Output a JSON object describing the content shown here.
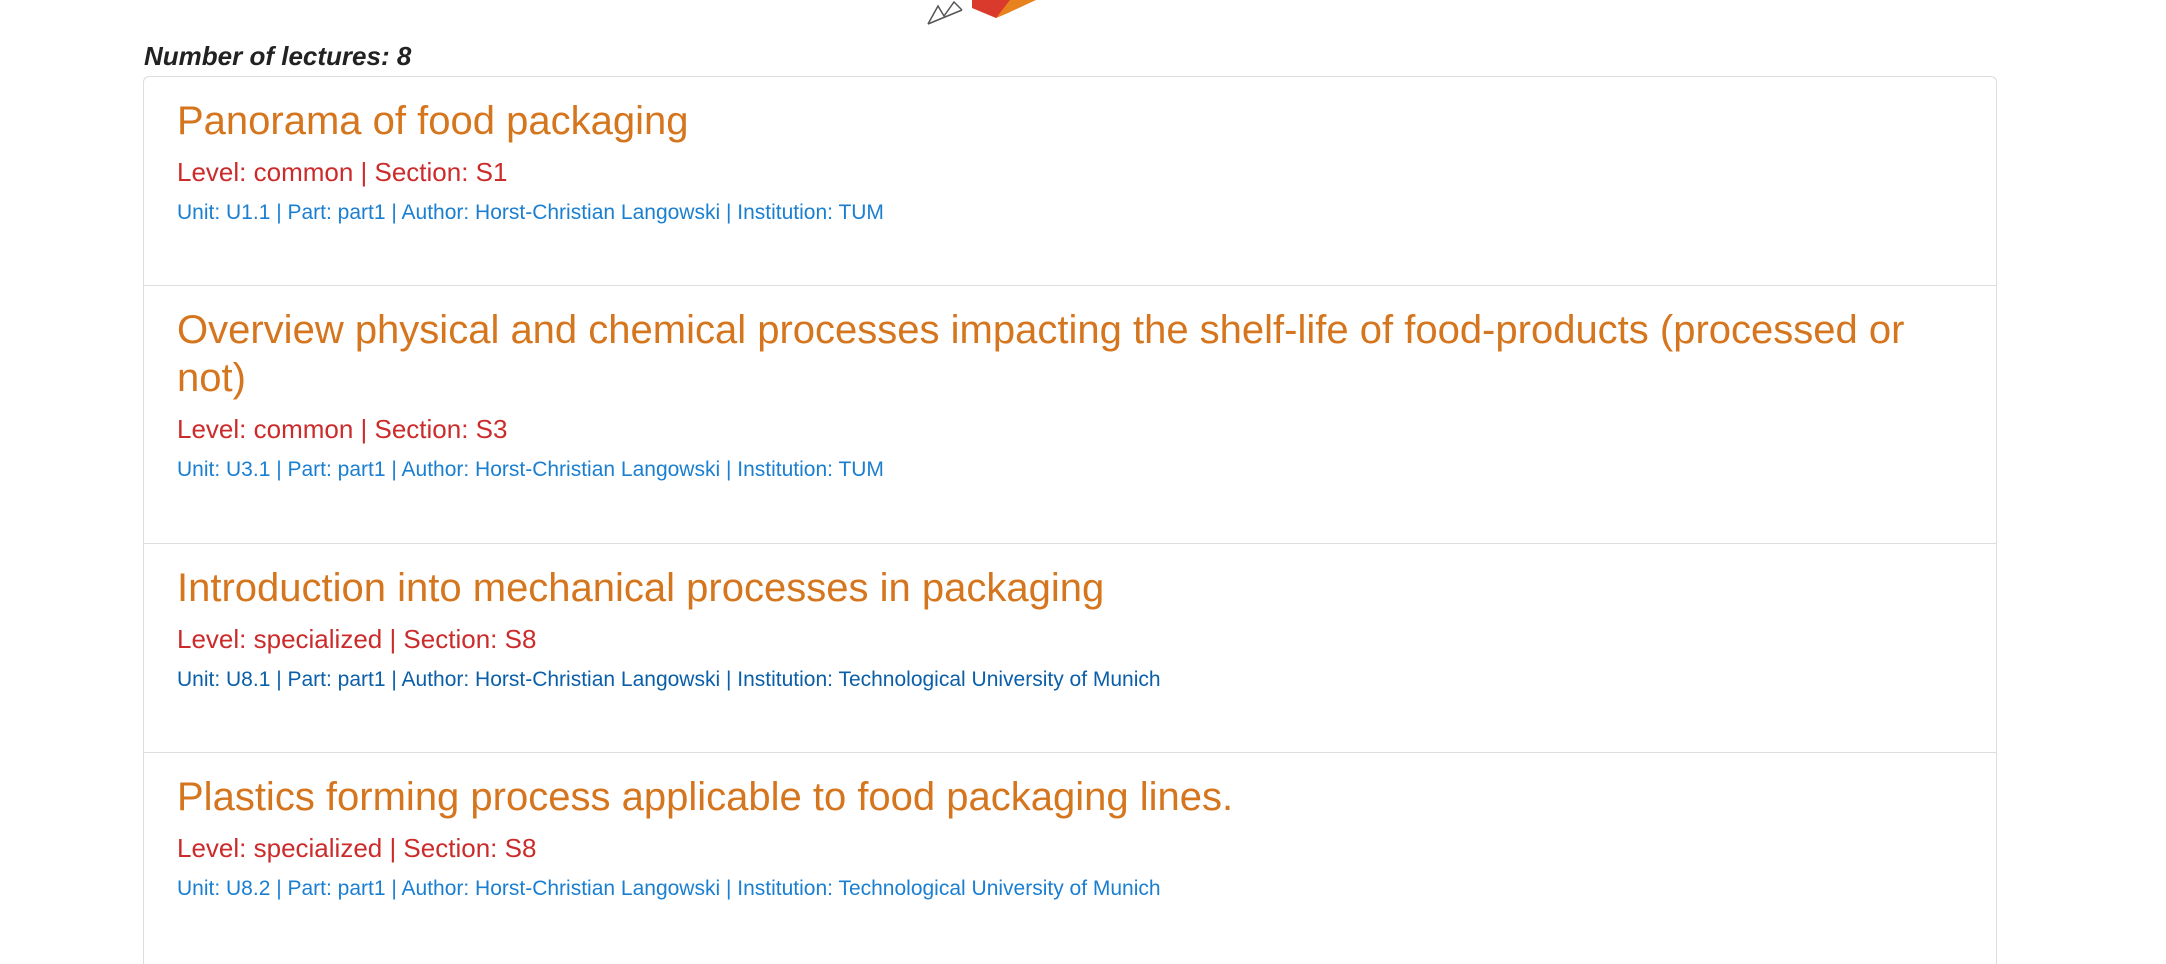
{
  "header": {
    "count_label": "Number of lectures: 8"
  },
  "lectures": [
    {
      "title": "Panorama of food packaging",
      "level_section": "Level: common | Section: S1",
      "meta": "Unit: U1.1 | Part: part1 | Author: Horst-Christian Langowski | Institution: TUM"
    },
    {
      "title": "Overview physical and chemical processes impacting the shelf-life of food-products (processed or not)",
      "level_section": "Level: common | Section: S3",
      "meta": "Unit: U3.1 | Part: part1 | Author: Horst-Christian Langowski | Institution: TUM"
    },
    {
      "title": "Introduction into mechanical processes in packaging",
      "level_section": "Level: specialized | Section: S8",
      "meta": "Unit: U8.1 | Part: part1 | Author: Horst-Christian Langowski | Institution: Technological University of Munich"
    },
    {
      "title": "Plastics forming process applicable to food packaging lines.",
      "level_section": "Level: specialized | Section: S8",
      "meta": "Unit: U8.2 | Part: part1 | Author: Horst-Christian Langowski | Institution: Technological University of Munich"
    }
  ],
  "colors": {
    "title": "#d5761f",
    "level": "#cc2b2b",
    "meta": "#1a7fd1",
    "logo_red": "#d93a2b",
    "logo_orange": "#e8821e"
  },
  "icons": {
    "logo": "site-logo-fragment"
  }
}
